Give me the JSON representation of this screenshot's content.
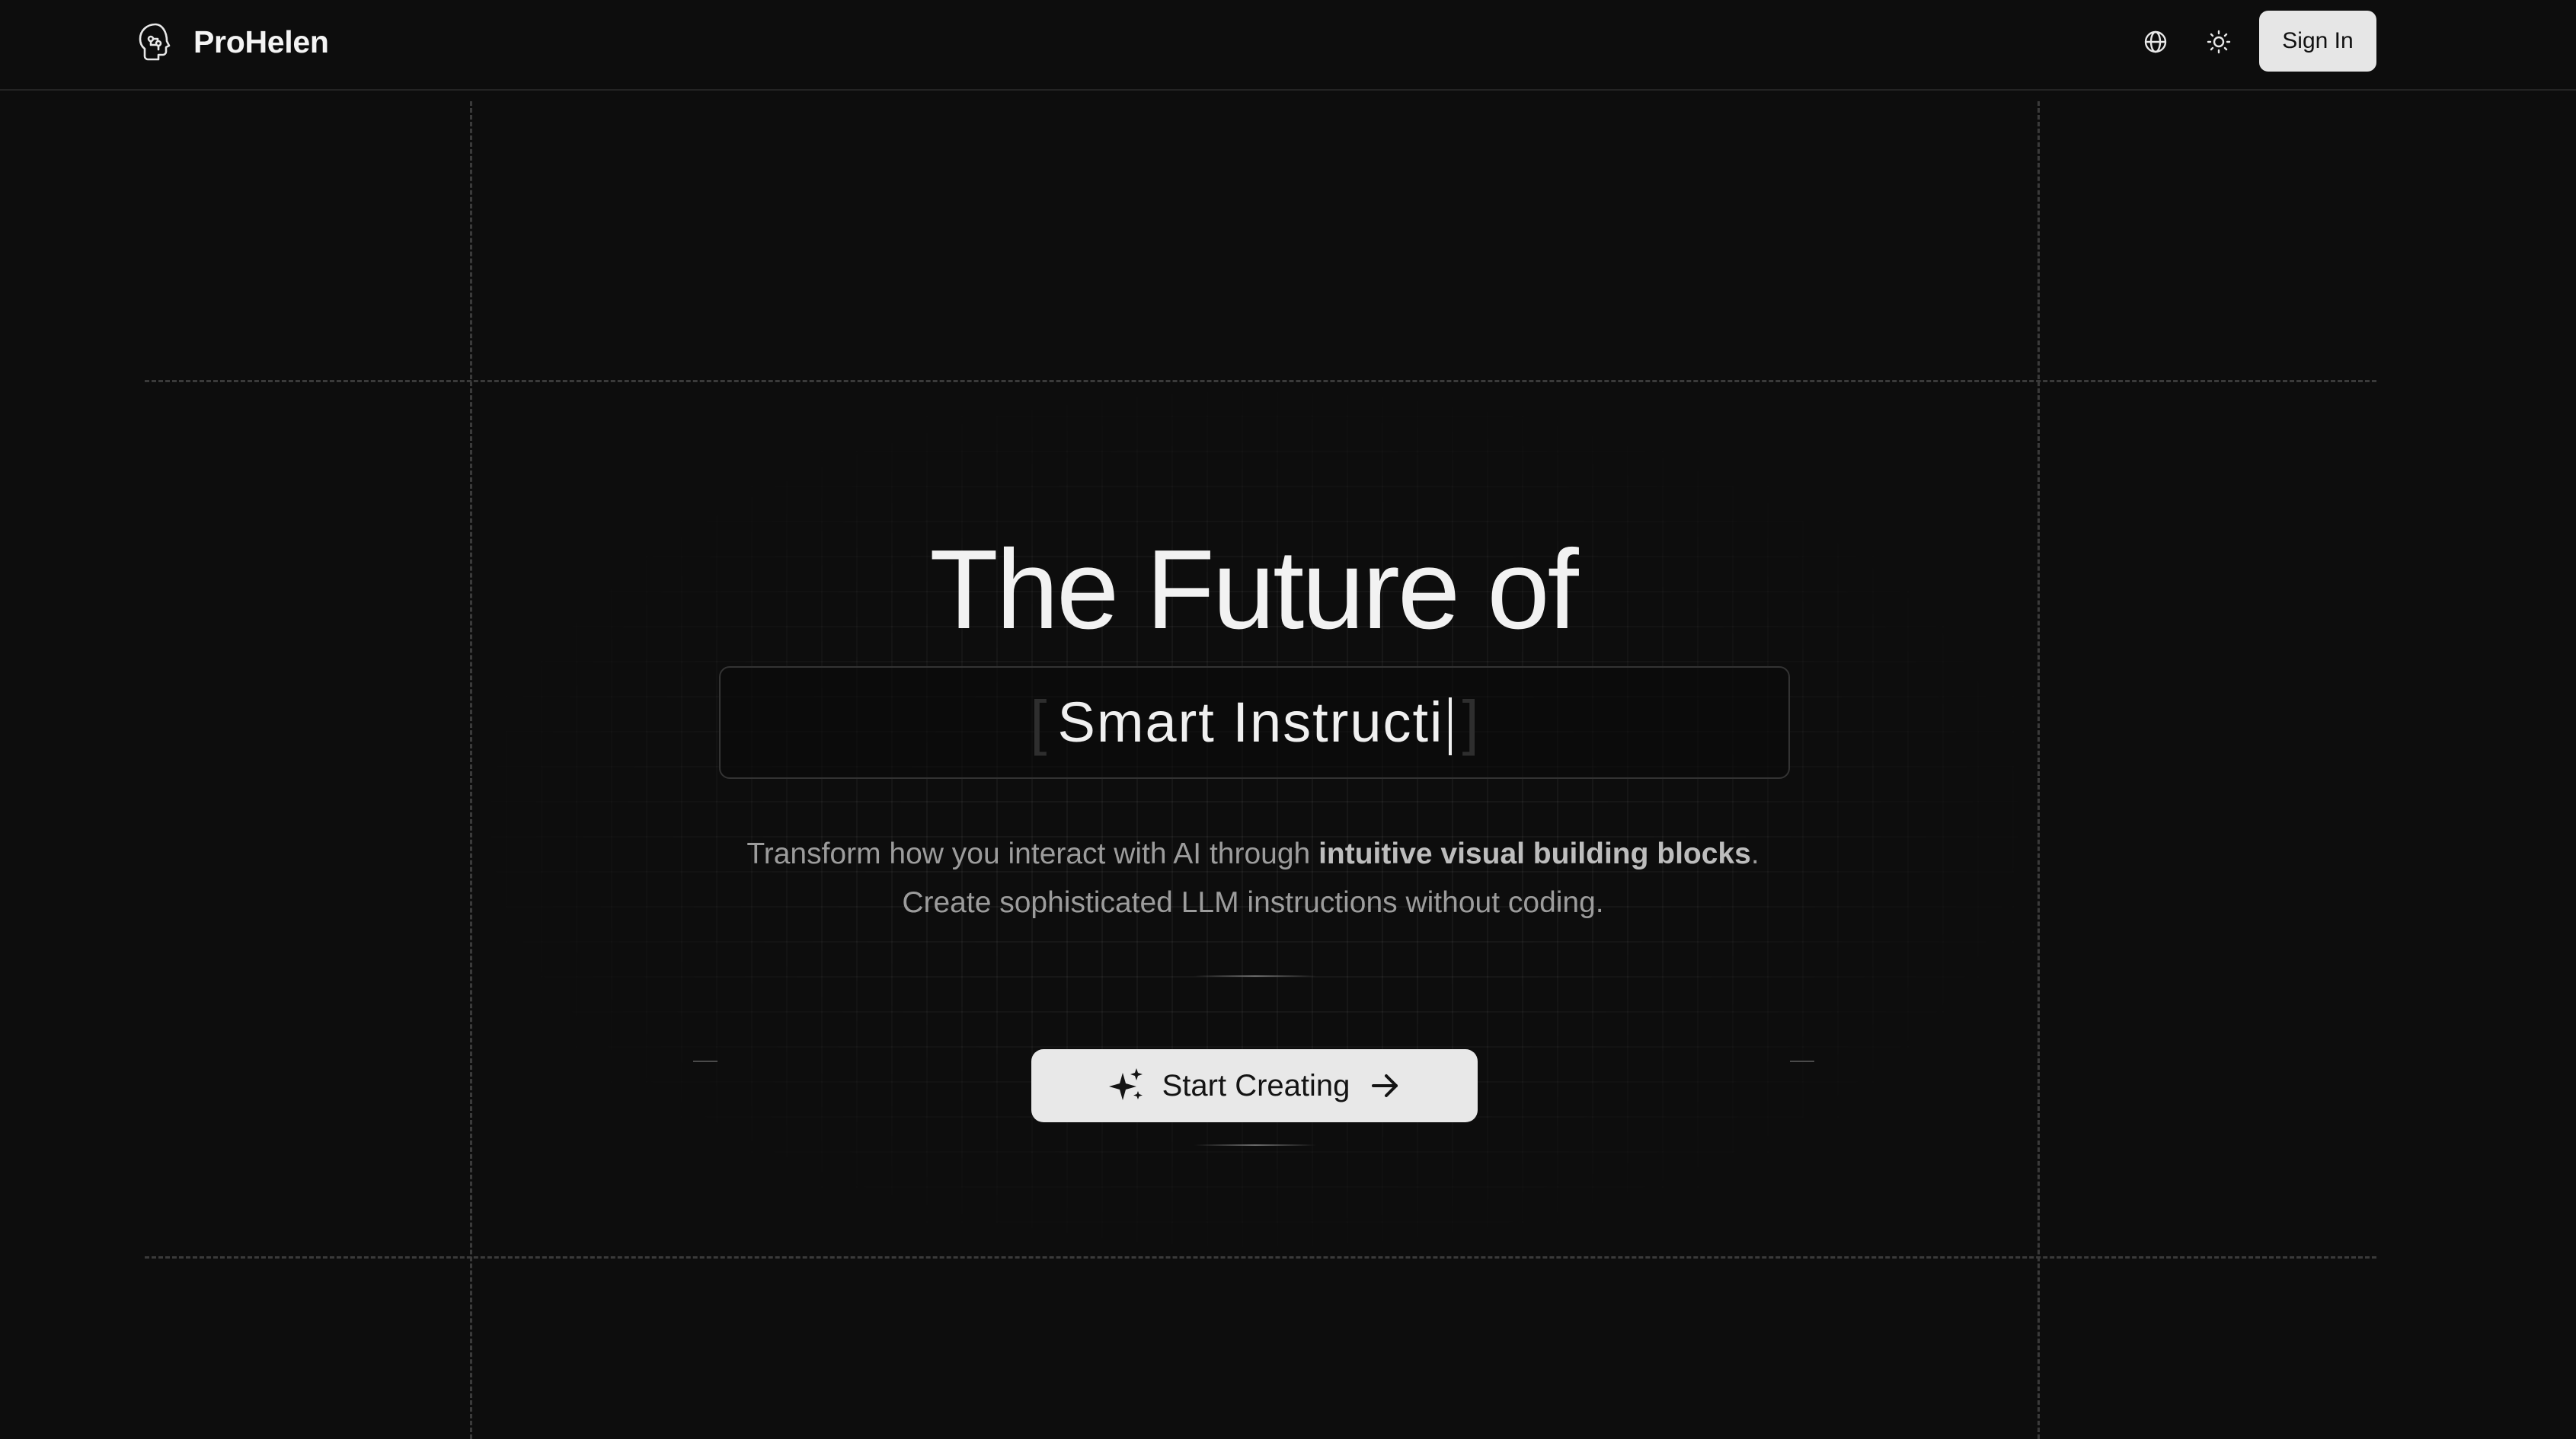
{
  "header": {
    "brand_name": "ProHelen",
    "logo_icon": "brain-head-icon",
    "language_icon": "globe-icon",
    "theme_icon": "sun-icon",
    "sign_in_label": "Sign In"
  },
  "hero": {
    "title": "The Future of",
    "typed_text": "Smart Instructi",
    "subtitle_pre": "Transform how you interact with AI through ",
    "subtitle_bold": "intuitive visual building blocks",
    "subtitle_post": ".",
    "subtitle_line2": "Create sophisticated LLM instructions without coding.",
    "cta_label": "Start Creating",
    "cta_icon": "sparkles-icon",
    "cta_arrow_icon": "arrow-right-icon"
  },
  "colors": {
    "background": "#0d0d0d",
    "button_bg": "#e8e8e8",
    "text_primary": "#f2f2f2",
    "text_muted": "#9c9c9c"
  }
}
